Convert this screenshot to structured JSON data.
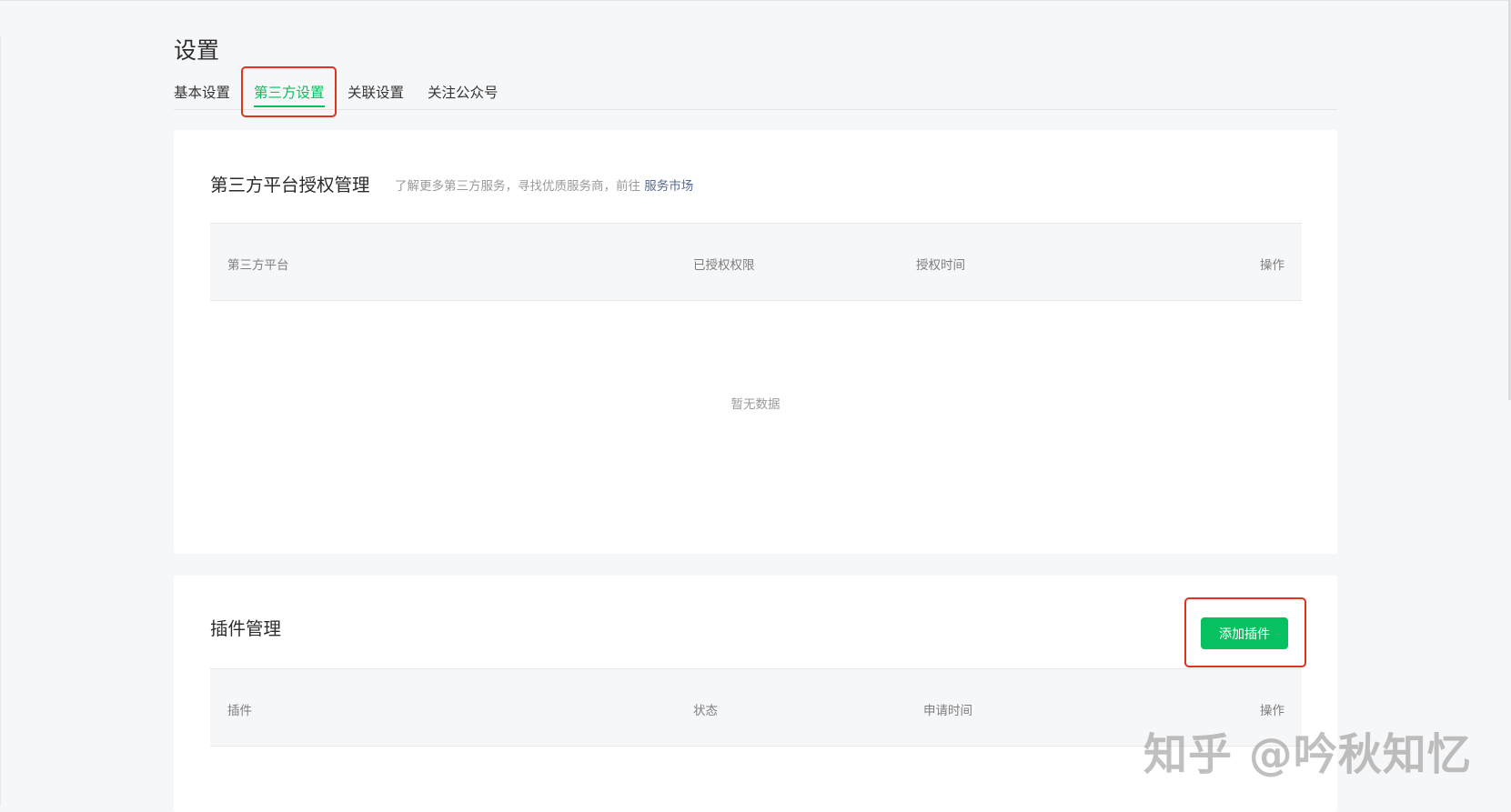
{
  "page": {
    "title": "设置"
  },
  "tabs": [
    {
      "label": "基本设置",
      "active": false
    },
    {
      "label": "第三方设置",
      "active": true
    },
    {
      "label": "关联设置",
      "active": false
    },
    {
      "label": "关注公众号",
      "active": false
    }
  ],
  "auth_section": {
    "title": "第三方平台授权管理",
    "desc_prefix": "了解更多第三方服务，寻找优质服务商，前往 ",
    "desc_link": "服务市场",
    "columns": [
      "第三方平台",
      "已授权权限",
      "授权时间",
      "操作"
    ],
    "empty_text": "暂无数据"
  },
  "plugin_section": {
    "title": "插件管理",
    "add_button": "添加插件",
    "columns": [
      "插件",
      "状态",
      "申请时间",
      "操作"
    ]
  },
  "watermark": "知乎 @吟秋知忆",
  "colors": {
    "accent": "#07c160",
    "highlight": "#e0321f",
    "link": "#576b95",
    "background": "#f6f7f9"
  }
}
